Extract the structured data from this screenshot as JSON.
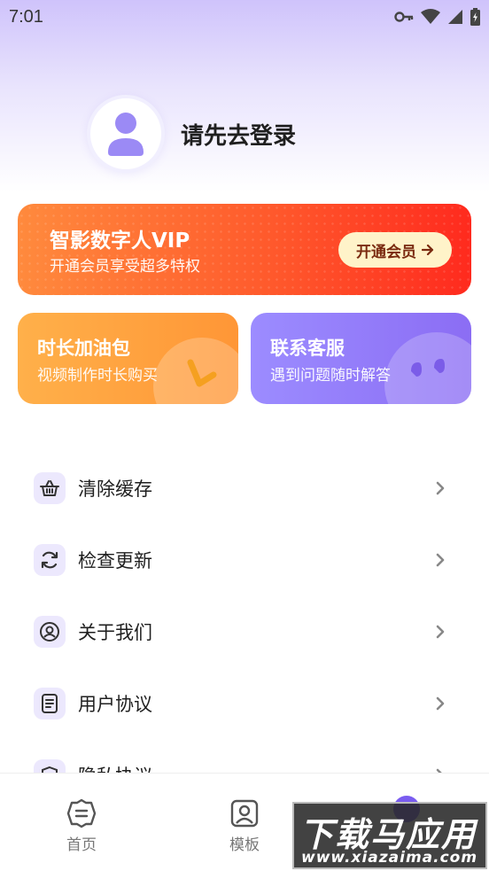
{
  "status_bar": {
    "time": "7:01"
  },
  "profile": {
    "login_text": "请先去登录"
  },
  "vip_card": {
    "title": "智影数字人VIP",
    "subtitle": "开通会员享受超多特权",
    "button": "开通会员"
  },
  "mini_cards": [
    {
      "title": "时长加油包",
      "subtitle": "视频制作时长购买"
    },
    {
      "title": "联系客服",
      "subtitle": "遇到问题随时解答"
    }
  ],
  "menu": [
    {
      "label": "清除缓存",
      "icon": "basket-icon"
    },
    {
      "label": "检查更新",
      "icon": "refresh-icon"
    },
    {
      "label": "关于我们",
      "icon": "user-circle-icon"
    },
    {
      "label": "用户协议",
      "icon": "document-icon"
    },
    {
      "label": "隐私协议",
      "icon": "shield-icon"
    }
  ],
  "tabbar": [
    {
      "label": "首页",
      "icon": "home-icon"
    },
    {
      "label": "模板",
      "icon": "template-icon"
    },
    {
      "label": "",
      "icon": "profile-icon"
    }
  ],
  "watermark": {
    "title": "下载马应用",
    "url": "www.xiazaima.com"
  },
  "colors": {
    "accent": "#8b6df4",
    "vip_orange": "#ff5a2c",
    "fuel_orange": "#ff9f3c"
  }
}
